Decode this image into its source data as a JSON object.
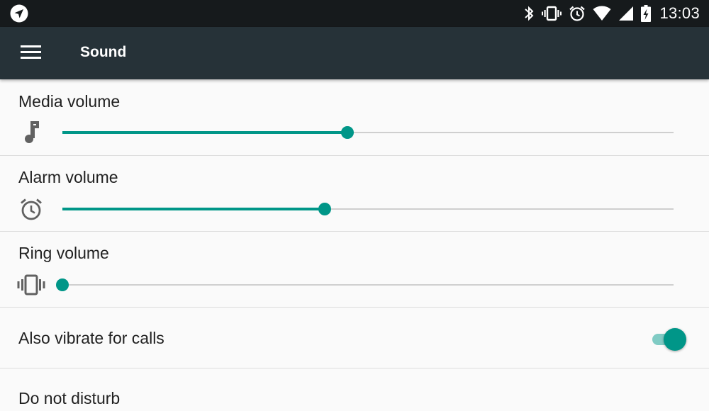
{
  "status_bar": {
    "time": "13:03",
    "icons": [
      "navigation-icon",
      "bluetooth-icon",
      "vibrate-icon",
      "alarm-icon",
      "wifi-icon",
      "signal-icon",
      "battery-charging-icon"
    ]
  },
  "app_bar": {
    "title": "Sound",
    "menu_icon": "menu-icon"
  },
  "settings": {
    "media_volume": {
      "label": "Media volume",
      "icon": "music-note-icon",
      "level": 0.466
    },
    "alarm_volume": {
      "label": "Alarm volume",
      "icon": "alarm-icon",
      "level": 0.429
    },
    "ring_volume": {
      "label": "Ring volume",
      "icon": "vibrate-icon",
      "level": 0.0
    },
    "vibrate_for_calls": {
      "label": "Also vibrate for calls",
      "enabled": true
    },
    "do_not_disturb": {
      "label": "Do not disturb"
    }
  },
  "colors": {
    "accent": "#009688",
    "accent_light": "#80cbc4",
    "app_bar": "#263238",
    "status_bar": "#161a1c",
    "background": "#fafafa",
    "text": "#212121",
    "icon_gray": "#616161"
  }
}
